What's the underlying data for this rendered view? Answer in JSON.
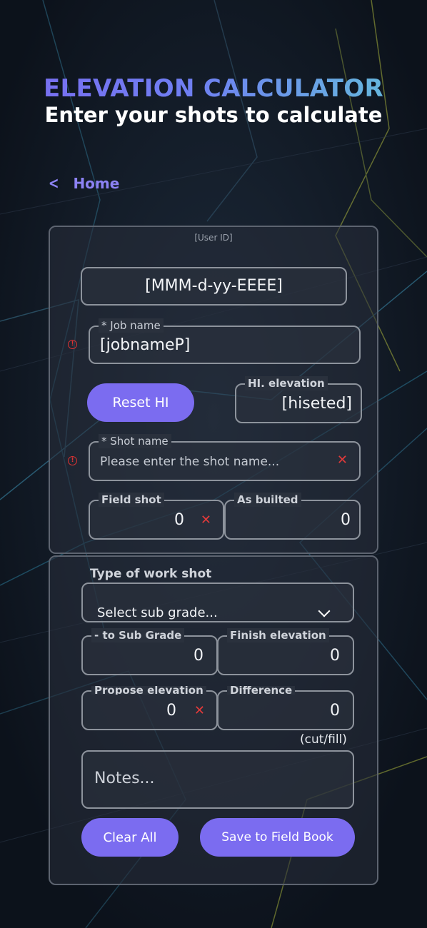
{
  "header": {
    "title": "ELEVATION CALCULATOR",
    "subtitle": "Enter your shots to calculate"
  },
  "nav": {
    "back_label": "Home",
    "back_icon": "chevron-left-icon"
  },
  "form": {
    "user_id": "[User ID]",
    "date_value": "[MMM-d-yy-EEEE]",
    "job_name": {
      "label": "* Job name",
      "value": "[jobnameP]"
    },
    "reset_hi_label": "Reset HI",
    "hi_elevation": {
      "label": "HI. elevation",
      "value": "[hiseted]"
    },
    "shot_name": {
      "label": "* Shot name",
      "placeholder": "Please enter the shot name..."
    },
    "field_shot": {
      "label": "Field shot",
      "value": "0"
    },
    "as_builted": {
      "label": "As builted",
      "value": "0"
    }
  },
  "work": {
    "type_label": "Type of work shot",
    "select_value": "Select sub grade...",
    "to_sub_grade": {
      "label": "- to Sub Grade",
      "value": "0"
    },
    "finish_elevation": {
      "label": "Finish elevation",
      "value": "0"
    },
    "propose_elevation": {
      "label": "Propose elevation",
      "value": "0"
    },
    "difference": {
      "label": "Difference",
      "value": "0"
    },
    "cut_fill": "(cut/fill)",
    "notes_placeholder": "Notes...",
    "clear_all_label": "Clear All",
    "save_label": "Save to Field Book"
  },
  "colors": {
    "accent": "#7b6cf0",
    "background": "#0f1722",
    "error": "#e23a3a",
    "title_gradient_start": "#7a6cf0",
    "title_gradient_end": "#63c2d8"
  }
}
